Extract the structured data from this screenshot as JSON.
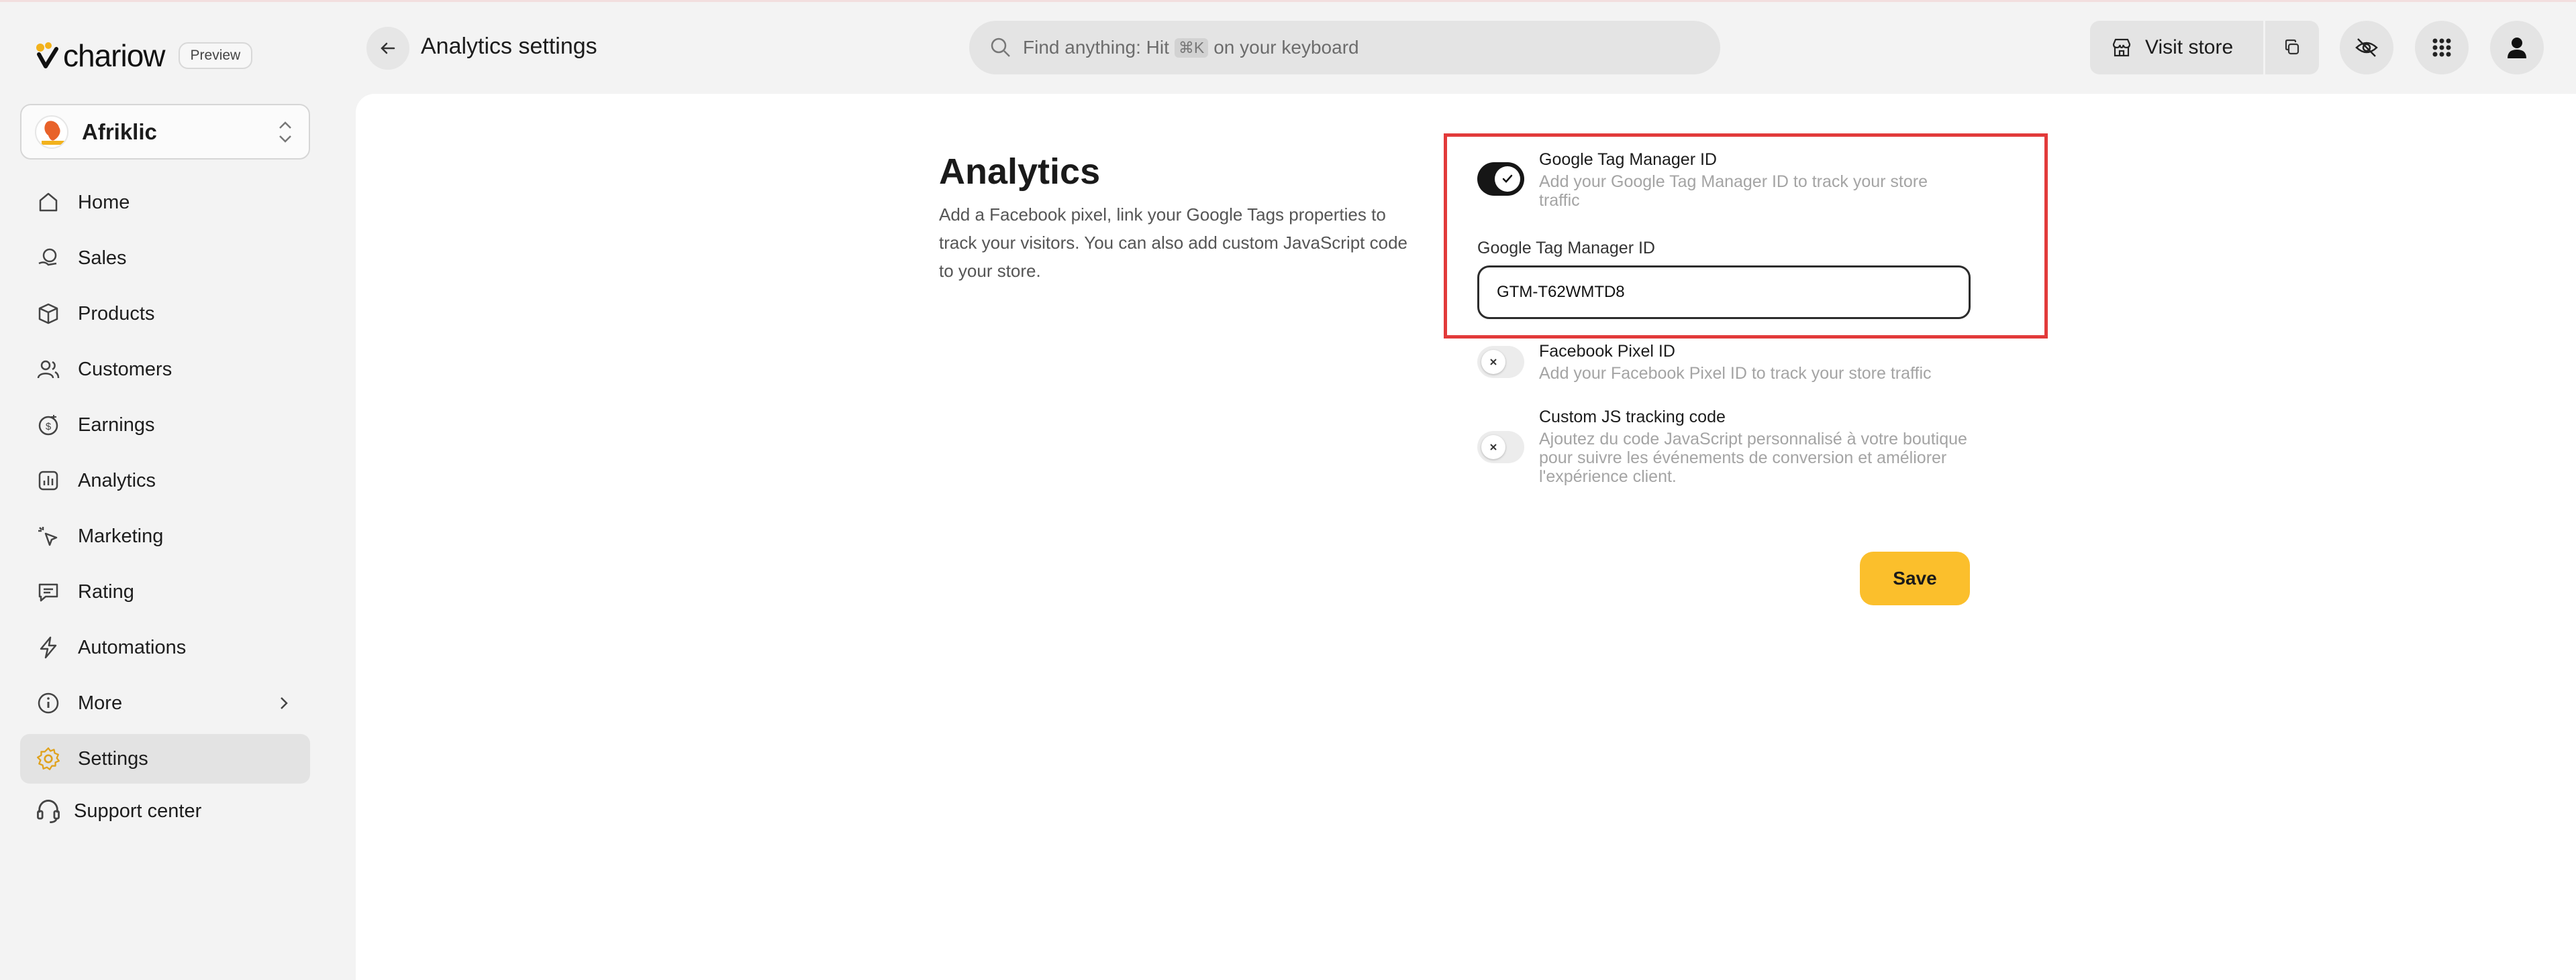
{
  "brand": {
    "name": "chariow",
    "badge": "Preview"
  },
  "store": {
    "name": "Afriklic"
  },
  "sidebar": {
    "items": [
      {
        "label": "Home",
        "icon": "home-icon"
      },
      {
        "label": "Sales",
        "icon": "sales-icon"
      },
      {
        "label": "Products",
        "icon": "box-icon"
      },
      {
        "label": "Customers",
        "icon": "users-icon"
      },
      {
        "label": "Earnings",
        "icon": "coin-icon"
      },
      {
        "label": "Analytics",
        "icon": "chart-icon"
      },
      {
        "label": "Marketing",
        "icon": "cursor-click-icon"
      },
      {
        "label": "Rating",
        "icon": "message-icon"
      },
      {
        "label": "Automations",
        "icon": "bolt-icon"
      },
      {
        "label": "More",
        "icon": "info-icon"
      },
      {
        "label": "Settings",
        "icon": "gear-icon",
        "active": true
      }
    ],
    "support": "Support center"
  },
  "header": {
    "title": "Analytics settings",
    "search": {
      "prefix": "Find anything: Hit",
      "shortcut": "⌘K",
      "suffix": "on your keyboard"
    },
    "visit_store": "Visit store"
  },
  "main": {
    "title": "Analytics",
    "description": "Add a Facebook pixel, link your Google Tags properties to track your visitors. You can also add custom JavaScript code to your store.",
    "options": [
      {
        "title": "Google Tag Manager ID",
        "description": "Add your Google Tag Manager ID to track your store traffic",
        "enabled": true
      },
      {
        "title": "Facebook Pixel ID",
        "description": "Add your Facebook Pixel ID to track your store traffic",
        "enabled": false
      },
      {
        "title": "Custom JS tracking code",
        "description": "Ajoutez du code JavaScript personnalisé à votre boutique pour suivre les événements de conversion et améliorer l'expérience client.",
        "enabled": false
      }
    ],
    "gtm_field": {
      "label": "Google Tag Manager ID",
      "value": "GTM-T62WMTD8"
    },
    "save_label": "Save"
  },
  "colors": {
    "accent": "#fbbf2c",
    "highlight": "#e23a3a",
    "toggle_on": "#161616"
  }
}
